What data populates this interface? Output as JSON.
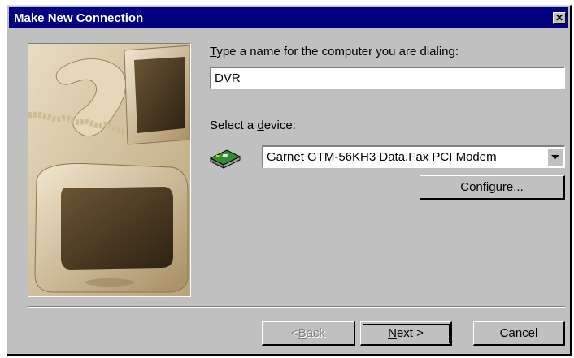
{
  "window": {
    "title": "Make New Connection",
    "close_glyph": "✕"
  },
  "name_field": {
    "label_mnemonic": "T",
    "label_rest": "ype a name for the computer you are dialing:",
    "value": "DVR"
  },
  "device_field": {
    "label_before": "Select a ",
    "label_mnemonic": "d",
    "label_after": "evice:",
    "selected": "Garnet GTM-56KH3 Data,Fax PCI Modem",
    "icon": "modem-icon"
  },
  "buttons": {
    "configure_mnemonic": "C",
    "configure_rest": "onfigure...",
    "back_prefix": "< ",
    "back_mnemonic": "B",
    "back_rest": "ack",
    "next_mnemonic": "N",
    "next_rest": "ext >",
    "cancel": "Cancel"
  },
  "colors": {
    "titlebar": "#000080",
    "face": "#c0c0c0"
  }
}
